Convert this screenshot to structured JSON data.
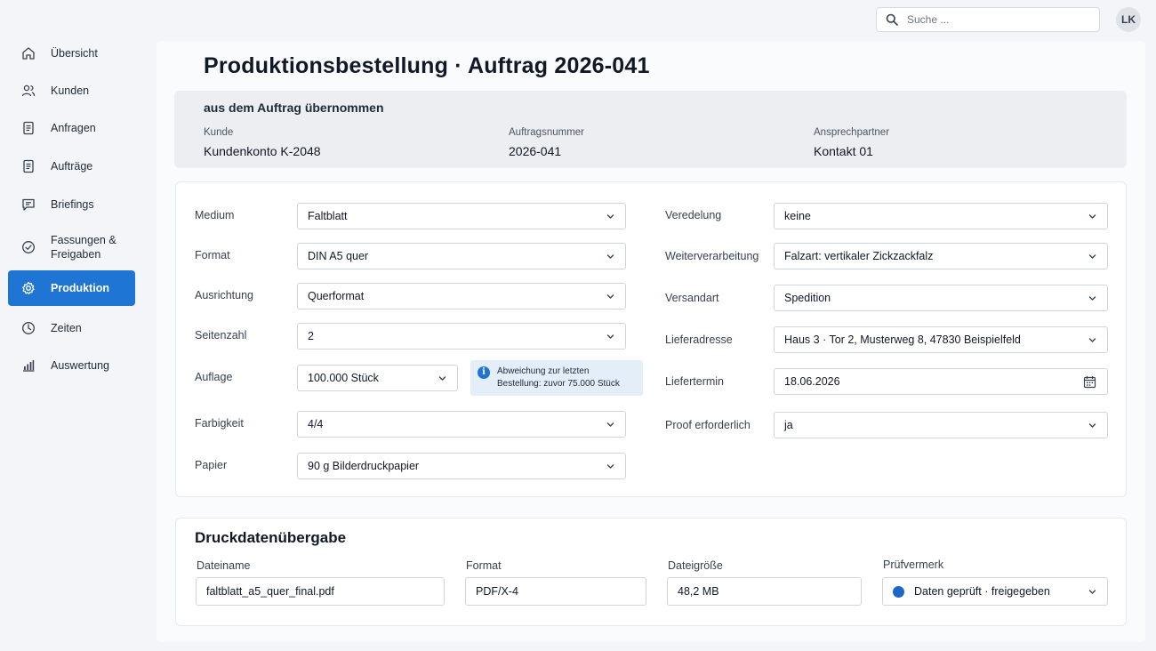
{
  "topbar": {
    "search_placeholder": "Suche ...",
    "avatar_initials": "LK"
  },
  "sidebar": {
    "items": [
      {
        "label": "Übersicht",
        "icon": "home-icon"
      },
      {
        "label": "Kunden",
        "icon": "users-icon"
      },
      {
        "label": "Anfragen",
        "icon": "document-icon"
      },
      {
        "label": "Aufträge",
        "icon": "document-icon"
      },
      {
        "label": "Briefings",
        "icon": "message-icon"
      },
      {
        "label": "Fassungen & Freigaben",
        "icon": "check-circle-icon"
      },
      {
        "label": "Produktion",
        "icon": "gear-icon",
        "active": true
      },
      {
        "label": "Zeiten",
        "icon": "clock-icon"
      },
      {
        "label": "Auswertung",
        "icon": "bar-chart-icon"
      }
    ]
  },
  "page": {
    "title": "Produktionsbestellung · Auftrag 2026-041"
  },
  "order_info": {
    "heading": "aus dem Auftrag übernommen",
    "customer_label": "Kunde",
    "customer_value": "Kundenkonto K-2048",
    "order_number_label": "Auftragsnummer",
    "order_number_value": "2026-041",
    "contact_label": "Ansprechpartner",
    "contact_value": "Kontakt 01"
  },
  "production": {
    "medium": {
      "label": "Medium",
      "value": "Faltblatt"
    },
    "format": {
      "label": "Format",
      "value": "DIN A5 quer"
    },
    "orientation": {
      "label": "Ausrichtung",
      "value": "Querformat"
    },
    "pages": {
      "label": "Seitenzahl",
      "value": "2"
    },
    "quantity": {
      "label": "Auflage",
      "value": "100.000 Stück"
    },
    "quantity_notice": {
      "line1": "Abweichung zur letzten",
      "line2": "Bestellung: zuvor 75.000 Stück"
    },
    "colors": {
      "label": "Farbigkeit",
      "value": "4/4"
    },
    "paper": {
      "label": "Papier",
      "value": "90 g Bilderdruckpapier"
    },
    "finishing": {
      "label": "Veredelung",
      "value": "keine"
    },
    "processing": {
      "label": "Weiterverarbeitung",
      "value": "Falzart: vertikaler Zickzackfalz"
    },
    "shipping": {
      "label": "Versandart",
      "value": "Spedition"
    },
    "delivery_address": {
      "label": "Lieferadresse",
      "value": "Haus 3 · Tor 2, Musterweg 8, 47830 Beispielfeld"
    },
    "delivery_date": {
      "label": "Liefertermin",
      "value": "18.06.2026"
    },
    "proof": {
      "label": "Proof erforderlich",
      "value": "ja"
    }
  },
  "print_data": {
    "title": "Druckdatenübergabe",
    "filename_label": "Dateiname",
    "filename_value": "faltblatt_a5_quer_final.pdf",
    "format_label": "Format",
    "format_value": "PDF/X-4",
    "filesize_label": "Dateigröße",
    "filesize_value": "48,2 MB",
    "check_label": "Prüfvermerk",
    "check_value": "Daten geprüft · freigegeben"
  },
  "colors": {
    "accent": "#1f75d3",
    "status_dot": "#1f66c9"
  }
}
